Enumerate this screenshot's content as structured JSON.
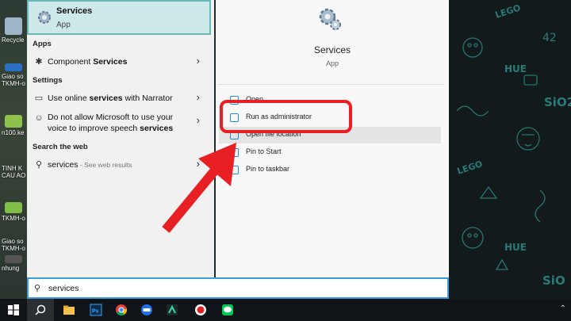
{
  "desktop": {
    "icons": [
      {
        "label": "Recycle"
      },
      {
        "label": "Giao so"
      },
      {
        "label": "TKMH-o"
      },
      {
        "label": "n100.ke"
      },
      {
        "label": "TINH K"
      },
      {
        "label": "CAU AO"
      },
      {
        "label": "TKMH-o"
      },
      {
        "label": "Giao so"
      },
      {
        "label": "TKMH-o"
      },
      {
        "label": "nhung"
      }
    ],
    "wallpaper_words": [
      "LEGO",
      "42",
      "HUE",
      "SiO2",
      "LEGO",
      "HUE",
      "SiO"
    ]
  },
  "start_menu": {
    "best_match": {
      "title": "Services",
      "subtitle": "App"
    },
    "sections": {
      "apps": "Apps",
      "settings": "Settings",
      "search_web": "Search the web"
    },
    "apps_items": [
      {
        "label_pre": "Component ",
        "label_bold": "Services"
      }
    ],
    "settings_items": [
      {
        "label_pre": "Use online ",
        "label_bold": "services",
        "label_post": " with Narrator"
      },
      {
        "line1": "Do not allow Microsoft to use your",
        "line2_pre": "voice to improve speech ",
        "line2_bold": "services"
      }
    ],
    "web_items": [
      {
        "label": "services",
        "suffix": " - See web results"
      }
    ],
    "details": {
      "title": "Services",
      "subtitle": "App",
      "actions": [
        {
          "label": "Open"
        },
        {
          "label": "Run as administrator"
        },
        {
          "label": "Open file location"
        },
        {
          "label": "Pin to Start"
        },
        {
          "label": "Pin to taskbar"
        }
      ]
    }
  },
  "search": {
    "query": "services"
  },
  "taskbar": {
    "items": [
      "windows-start",
      "search",
      "file-explorer",
      "photoshop",
      "chrome",
      "zalo",
      "filmora",
      "recorder",
      "line"
    ]
  },
  "colors": {
    "accent": "#3a9bd8",
    "best_match_bg": "#cce8e8",
    "annotation_red": "#e82024"
  }
}
